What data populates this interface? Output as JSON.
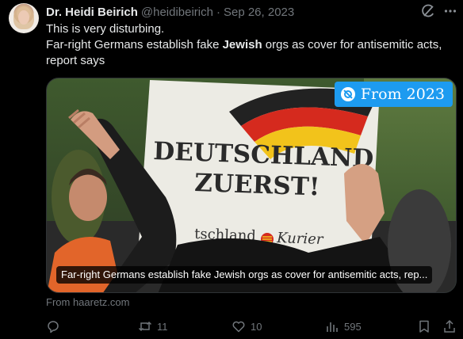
{
  "tweet": {
    "author_name": "Dr. Heidi Beirich",
    "handle": "@heidibeirich",
    "separator": "·",
    "date": "Sep 26, 2023",
    "text_line1": "This is very disturbing.",
    "text_line2_pre": "Far-right Germans establish fake ",
    "text_line2_bold": "Jewish",
    "text_line2_post": " orgs as cover for antisemitic acts,",
    "text_line3": "report says"
  },
  "card": {
    "badge_label": "From 2023",
    "sign_line1": "DEUTSCHLAND",
    "sign_line2": "ZUERST!",
    "sign_footer_pre": "tschland",
    "sign_footer_post": "Kurier",
    "caption": "Far-right Germans establish fake Jewish orgs as cover for antisemitic acts, rep...",
    "source": "From haaretz.com"
  },
  "actions": {
    "reply_icon": "reply-icon",
    "retweet_count": "11",
    "like_count": "10",
    "views_count": "595",
    "bookmark_icon": "bookmark-icon",
    "share_icon": "share-icon"
  },
  "colors": {
    "background": "#000000",
    "text": "#e7e9ea",
    "muted": "#71767b",
    "accent": "#1d9bf0"
  }
}
